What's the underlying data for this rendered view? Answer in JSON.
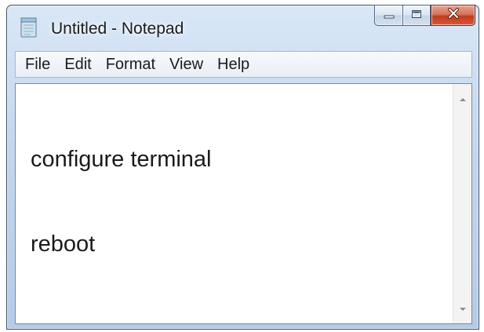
{
  "window": {
    "title": "Untitled - Notepad",
    "icon": "notepad-icon",
    "caption_buttons": {
      "minimize_icon": "minimize-icon",
      "maximize_icon": "maximize-icon",
      "close_icon": "close-icon"
    }
  },
  "menu": {
    "items": [
      {
        "label": "File"
      },
      {
        "label": "Edit"
      },
      {
        "label": "Format"
      },
      {
        "label": "View"
      },
      {
        "label": "Help"
      }
    ]
  },
  "editor": {
    "lines": [
      "configure terminal",
      "reboot"
    ]
  },
  "scrollbar": {
    "up_icon": "scroll-up-arrow-icon",
    "down_icon": "scroll-down-arrow-icon"
  },
  "colors": {
    "frame": "#c3d6ee",
    "close_button": "#c33c1c",
    "text": "#1a1a1a"
  }
}
